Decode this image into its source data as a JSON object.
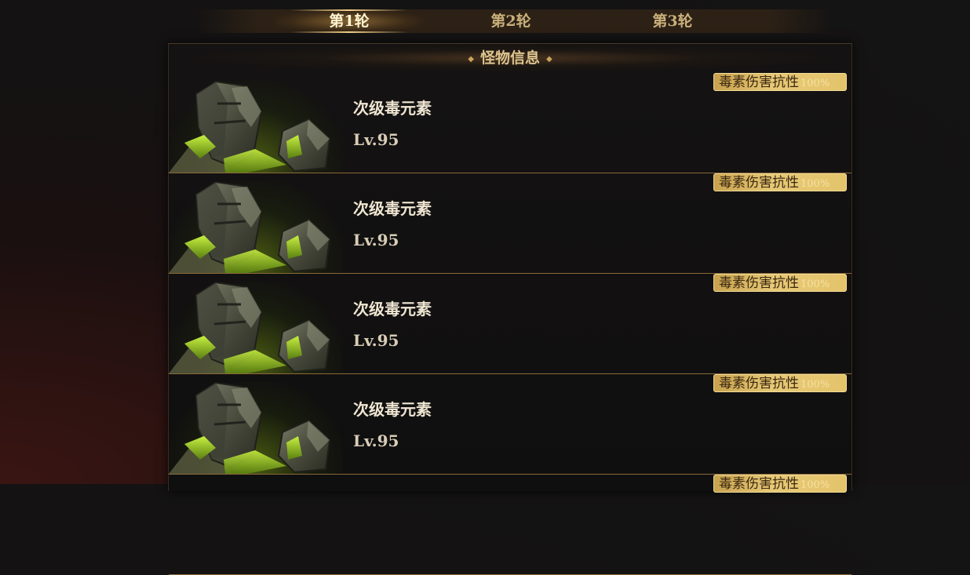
{
  "tabs": [
    {
      "label": "第1轮",
      "active": true
    },
    {
      "label": "第2轮",
      "active": false
    },
    {
      "label": "第3轮",
      "active": false
    }
  ],
  "panel": {
    "title": "怪物信息",
    "monsters": [
      {
        "name": "次级毒元素",
        "level": "Lv.95",
        "resistance": "毒素伤害抗性",
        "resistance_value": "100%"
      },
      {
        "name": "次级毒元素",
        "level": "Lv.95",
        "resistance": "毒素伤害抗性",
        "resistance_value": "100%"
      },
      {
        "name": "次级毒元素",
        "level": "Lv.95",
        "resistance": "毒素伤害抗性",
        "resistance_value": "100%"
      },
      {
        "name": "次级毒元素",
        "level": "Lv.95",
        "resistance": "毒素伤害抗性",
        "resistance_value": "100%"
      },
      {
        "name": "",
        "level": "",
        "resistance": "毒素伤害抗性",
        "resistance_value": "100%"
      }
    ]
  },
  "colors": {
    "accent_gold": "#e4c36a",
    "text_light": "#efe6d2",
    "poison_green": "#8ec21a"
  }
}
